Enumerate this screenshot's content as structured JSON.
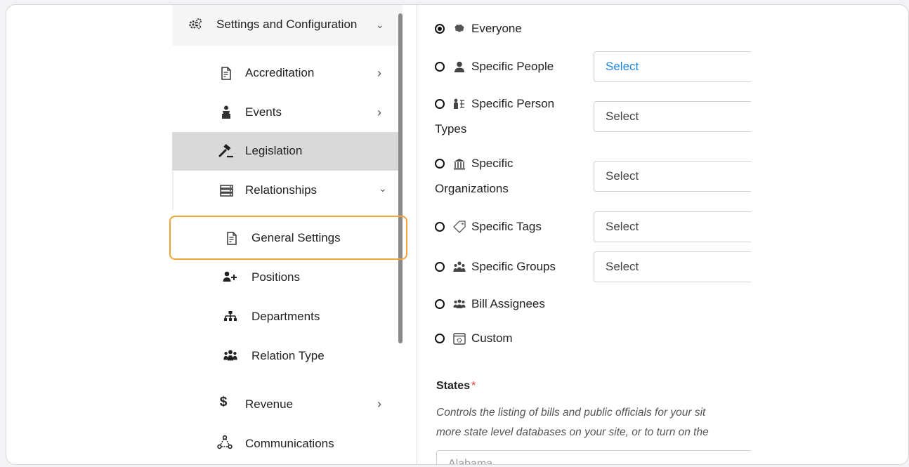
{
  "sidebar": {
    "top": {
      "label": "Settings and Configuration",
      "icon": "gears-icon"
    },
    "items": [
      {
        "label": "Accreditation",
        "icon": "document-icon",
        "chevron": "›"
      },
      {
        "label": "Events",
        "icon": "podium-icon",
        "chevron": "›"
      },
      {
        "label": "Legislation",
        "icon": "gavel-icon",
        "chevron": ""
      },
      {
        "label": "Relationships",
        "icon": "server-icon",
        "chevron": "⌄"
      },
      {
        "label": "General Settings",
        "icon": "document-icon"
      },
      {
        "label": "Positions",
        "icon": "user-plus-icon"
      },
      {
        "label": "Departments",
        "icon": "org-chart-icon"
      },
      {
        "label": "Relation Type",
        "icon": "people-group-icon"
      },
      {
        "label": "Revenue",
        "icon": "dollar-icon",
        "chevron": "›"
      },
      {
        "label": "Communications",
        "icon": "network-icon",
        "chevron": ""
      }
    ]
  },
  "visibility": {
    "selected": "Everyone",
    "options": [
      {
        "label": "Everyone",
        "icon": "brain-icon"
      },
      {
        "label": "Specific People",
        "icon": "person-icon",
        "select": "Select"
      },
      {
        "label": "Specific Person",
        "label2": "Types",
        "icon": "person-types-icon",
        "select": "Select"
      },
      {
        "label": "Specific",
        "label2": "Organizations",
        "icon": "institution-icon",
        "select": "Select"
      },
      {
        "label": "Specific Tags",
        "icon": "tag-icon",
        "select": "Select"
      },
      {
        "label": "Specific Groups",
        "icon": "group-icon",
        "select": "Select"
      },
      {
        "label": "Bill Assignees",
        "icon": "users-icon"
      },
      {
        "label": "Custom",
        "icon": "window-gear-icon"
      }
    ]
  },
  "states": {
    "label": "States",
    "required_mark": "*",
    "desc_line1": "Controls the listing of bills and public officials for your sit",
    "desc_line2": "more state level databases on your site, or to turn on the",
    "value": "Alabama"
  }
}
